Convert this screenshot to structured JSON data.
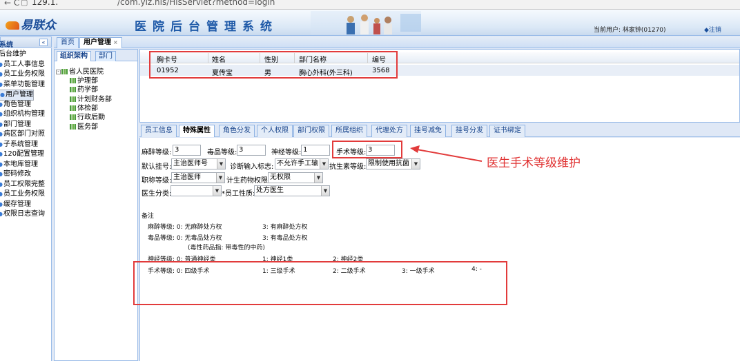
{
  "browser": {
    "nav": "←  C",
    "page_icon": "▢",
    "url_host": "129.1.",
    "url_path": "/com.ylz.his/HisServlet?method=login"
  },
  "header": {
    "logo": "易联众",
    "system_title": "医院后台管理系统",
    "current_user": "当前用户: 林家钟(01270)",
    "logout": "◆注销"
  },
  "left": {
    "title": "系统",
    "collapse": "«",
    "items": [
      "后台维护",
      "员工人事信息",
      "员工业务权限",
      "菜单功能管理",
      "用户管理",
      "角色管理",
      "组织机构管理",
      "部门管理",
      "病区部门对照",
      "子系统管理",
      "120配置管理",
      "本地库管理",
      "密码修改",
      "员工权限完整",
      "员工业务权限",
      "缓存管理",
      "权限日志查询"
    ]
  },
  "tabs": {
    "home": "首页",
    "user_mgmt": "用户管理",
    "close": "×"
  },
  "org": {
    "tabs": [
      "组织架构",
      "部门"
    ],
    "root": "省人民医院",
    "children": [
      "护理部",
      "药学部",
      "计划财务部",
      "体检部",
      "行政后勤",
      "医务部"
    ]
  },
  "grid": {
    "headers": [
      "胸卡号",
      "姓名",
      "性别",
      "部门名称",
      "编号"
    ],
    "rows": [
      {
        "card": "01952",
        "name": "夏传宝",
        "sex": "男",
        "dept": "胸心外科(外三科)",
        "no": "3568"
      }
    ]
  },
  "detail_tabs": [
    "员工信息",
    "特殊属性",
    "角色分发",
    "个人权限",
    "部门权限",
    "所属组织",
    "代理处方",
    "挂号减免",
    "挂号分发",
    "证书绑定"
  ],
  "form": {
    "anesthesia_label": "麻醉等级:",
    "anesthesia_value": "3",
    "poison_label": "毒品等级:",
    "poison_value": "3",
    "nerve_label": "神经等级:",
    "nerve_value": "1",
    "surgery_label": "手术等级:",
    "surgery_value": "3",
    "default_reg_label": "默认挂号:",
    "default_reg_value": "主治医师号",
    "diag_input_label": "诊断输入标志:",
    "diag_input_value": "不允许手工输",
    "antibiotic_label": "抗生素等级:",
    "antibiotic_value": "限制使用抗菌",
    "title_label": "职称等级:",
    "title_value": "主治医师",
    "family_label": "计生药物权限:",
    "family_value": "无权限",
    "doc_class_label": "医生分类:",
    "doc_class_value": "",
    "staff_type_label": "*员工性质:",
    "staff_type_value": "处方医生"
  },
  "notes": {
    "header": "备注",
    "anesthesia": "麻醉等级:  0: 无麻醉处方权",
    "anesthesia_3": "3: 有麻醉处方权",
    "poison": "毒品等级:  0: 无毒品处方权",
    "poison_3": "3: 有毒品处方权",
    "poison_hint": "(毒性药品指: 带毒性的中药)",
    "nerve": "神经等级:  0: 普通神经类",
    "nerve_1": "1: 神经1类",
    "nerve_2": "2: 神经2类",
    "surgery": "手术等级:  0: 四级手术",
    "surgery_1": "1: 三级手术",
    "surgery_2": "2: 二级手术",
    "surgery_3": "3: 一级手术",
    "surgery_4": "4: -"
  },
  "annotation": "医生手术等级维护",
  "colors": {
    "accent": "#15428b",
    "annotation_red": "#e23b3b",
    "panel_border": "#99bbe8"
  }
}
